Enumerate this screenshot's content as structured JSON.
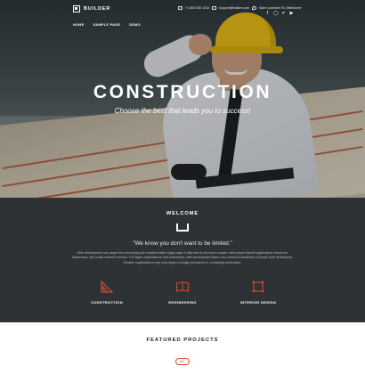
{
  "brand": {
    "name": "BUILDER"
  },
  "topbar": {
    "phone": "+1 800 555 1234",
    "email": "support@builder.com",
    "address": "Saint Lavender St, Melbourne",
    "socials": [
      "facebook-icon",
      "instagram-icon",
      "twitter-icon",
      "youtube-icon"
    ]
  },
  "nav": {
    "items": [
      "HOME",
      "SAMPLE PAGE",
      "DEMO"
    ]
  },
  "hero": {
    "title": "CONSTRUCTION",
    "subtitle": "Choose the best that leads you to success!"
  },
  "welcome": {
    "title": "WELCOME",
    "quote": "\"We know you don't want to be limited.\"",
    "body": "Web development can range from developing the simplest static single page of plain text to the most complex web-based internet applications, electronic businesses, and social network services. For larger organizations and businesses, web development teams can consist of hundreds of people (web developers). Smaller organizations may only require a single permanent or contracting webmaster."
  },
  "features": [
    {
      "label": "CONSTRUCTION",
      "icon": "ruler-triangle-icon"
    },
    {
      "label": "ENGINEERING",
      "icon": "blueprint-book-icon"
    },
    {
      "label": "INTERIOR DESIGN",
      "icon": "frame-square-icon"
    }
  ],
  "featured": {
    "title": "FEATURED PROJECTS",
    "pill": "ALL"
  },
  "colors": {
    "accent": "#d04b2e",
    "dark_section": "#2f3235",
    "helmet": "#f4c20d"
  }
}
